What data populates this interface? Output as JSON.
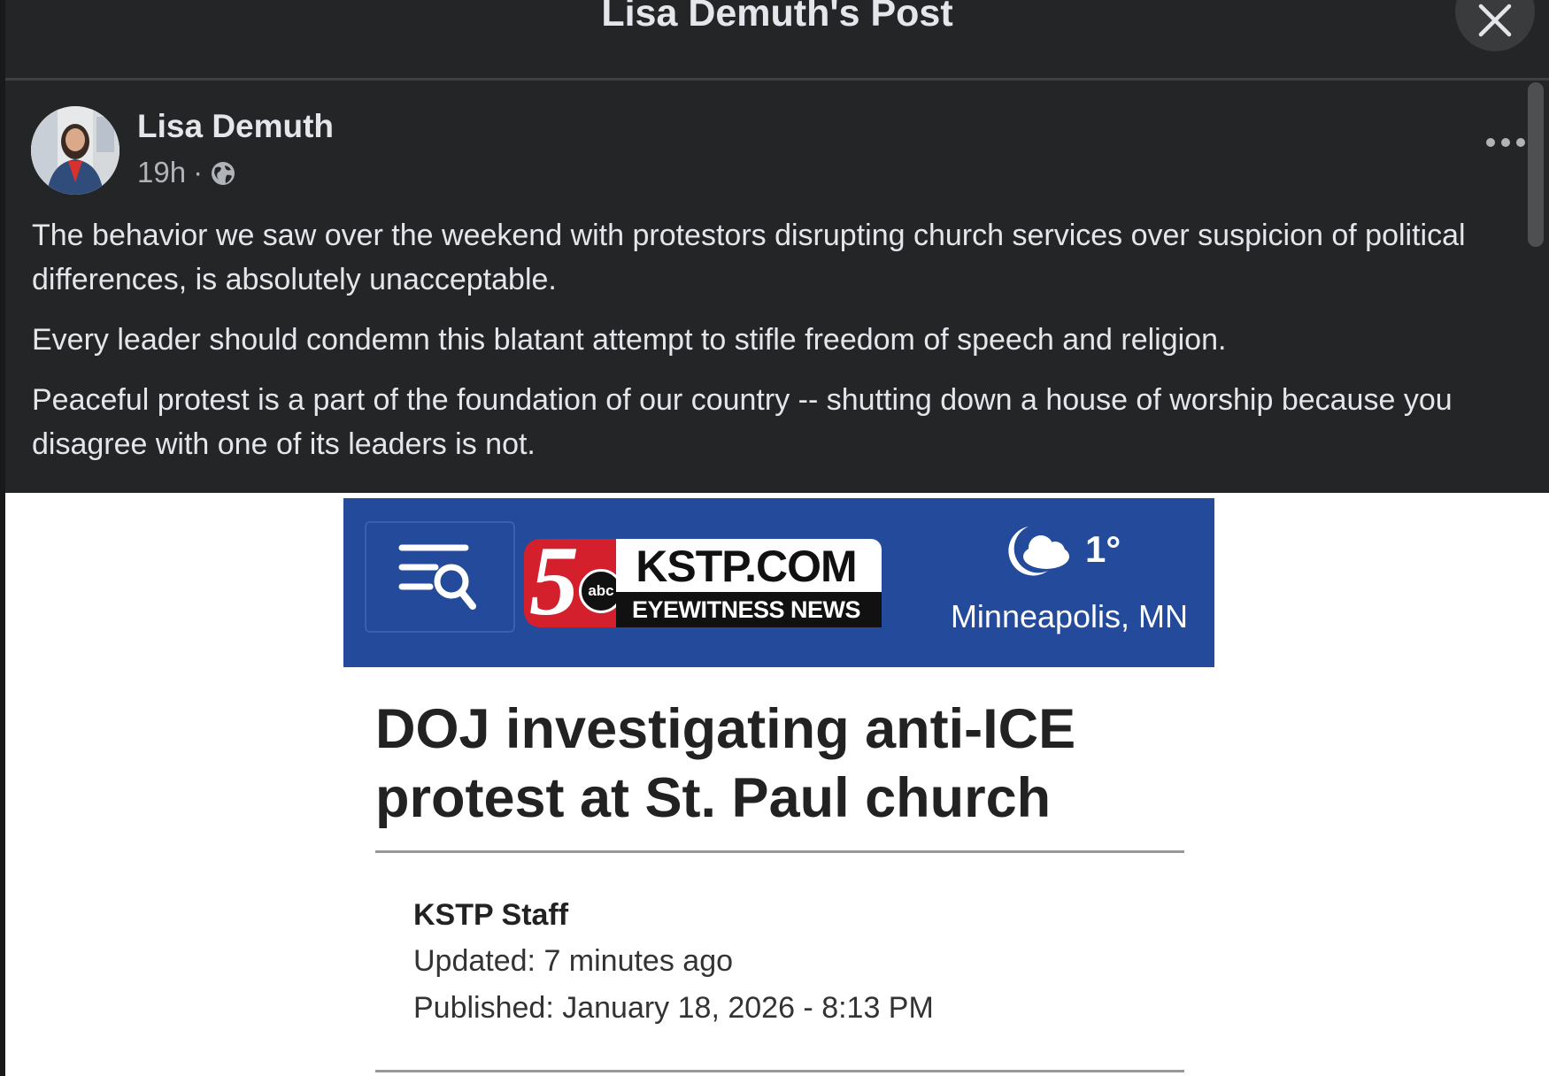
{
  "header": {
    "title": "Lisa Demuth's Post"
  },
  "post": {
    "author": "Lisa Demuth",
    "time": "19h",
    "separator": "·",
    "paragraphs": [
      "The behavior we saw over the weekend with protestors disrupting church services over suspicion of political differences, is absolutely unacceptable.",
      "Every leader should condemn this blatant attempt to stifle freedom of speech and religion.",
      "Peaceful protest is a part of the foundation of our country -- shutting down a house of worship because you disagree with one of its leaders is not."
    ]
  },
  "article": {
    "logo": {
      "number": "5",
      "network": "abc",
      "site": "KSTP.COM",
      "tagline": "EYEWITNESS NEWS"
    },
    "weather": {
      "temp": "1°",
      "city": "Minneapolis, MN"
    },
    "headline": "DOJ investigating anti-ICE protest at St. Paul church",
    "byline": "KSTP Staff",
    "updated": "Updated: 7 minutes ago",
    "published": "Published: January 18, 2026 - 8:13 PM"
  },
  "icons": {
    "close": "close-icon",
    "more": "more-options-icon",
    "privacy": "globe-icon",
    "search_menu": "menu-search-icon",
    "weather": "partly-cloudy-night-icon"
  },
  "colors": {
    "dark_bg": "#242526",
    "text": "#e4e6eb",
    "secondary_text": "#b0b3b8",
    "kstp_blue": "#234a9b",
    "kstp_red": "#d3202c"
  }
}
